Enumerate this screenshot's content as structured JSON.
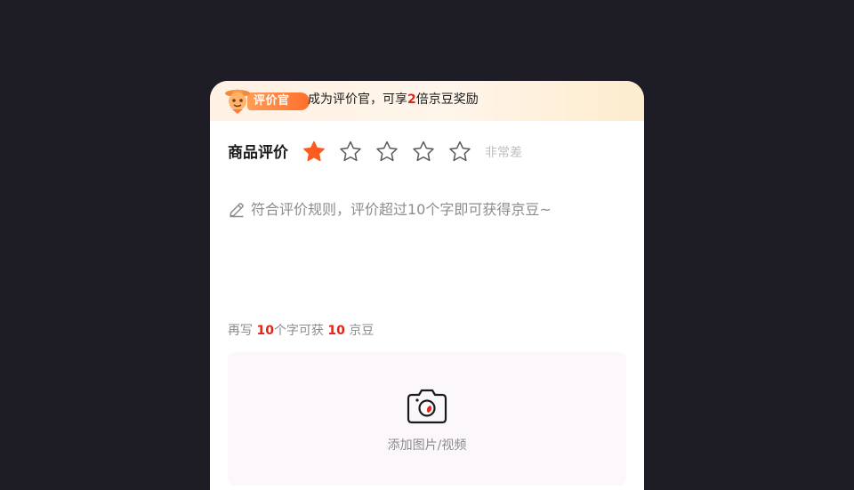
{
  "banner": {
    "badge_label": "评价官",
    "text_prefix": "成为评价官，可享",
    "text_highlight": "2",
    "text_suffix": "倍京豆奖励"
  },
  "rating": {
    "label": "商品评价",
    "value": 1,
    "max": 5,
    "description": "非常差",
    "active_color": "#fa5c1f",
    "inactive_color": "#595959"
  },
  "review": {
    "placeholder": "符合评价规则，评价超过10个字即可获得京豆~"
  },
  "hint": {
    "part1": "再写",
    "chars": "10",
    "part2": "个字可获",
    "beans": "10",
    "part3": "京豆"
  },
  "upload": {
    "label": "添加图片/视频"
  },
  "icons": {
    "badge": "mascot-badge-icon",
    "star": "star-icon",
    "pencil": "pencil-icon",
    "camera": "camera-icon"
  }
}
